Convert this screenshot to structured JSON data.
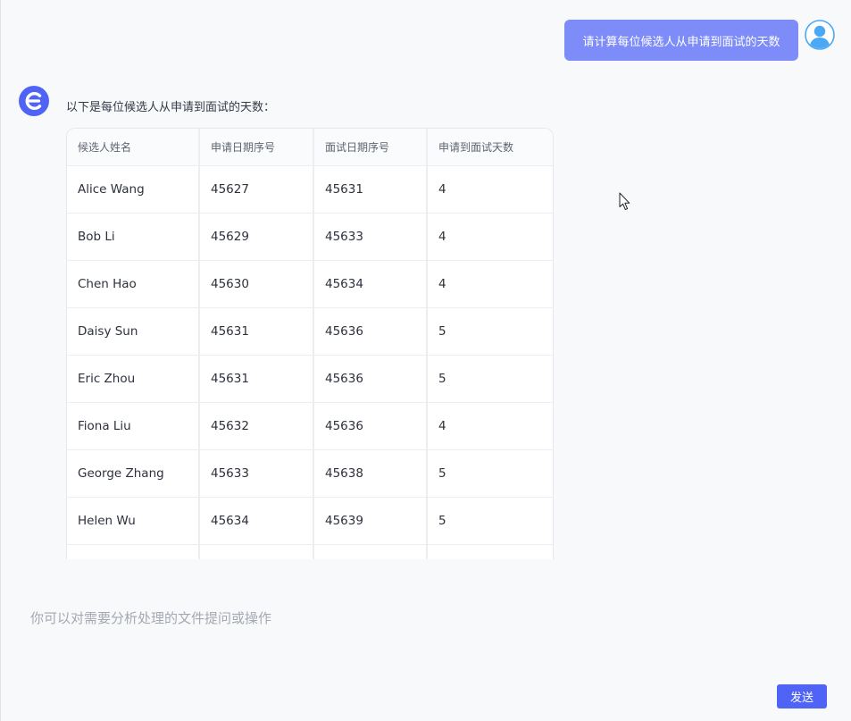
{
  "user_message": {
    "text": "请计算每位候选人从申请到面试的天数"
  },
  "assistant_message": {
    "intro": "以下是每位候选人从申请到面试的天数：",
    "table": {
      "headers": [
        "候选人姓名",
        "申请日期序号",
        "面试日期序号",
        "申请到面试天数"
      ],
      "rows": [
        [
          "Alice Wang",
          "45627",
          "45631",
          "4"
        ],
        [
          "Bob Li",
          "45629",
          "45633",
          "4"
        ],
        [
          "Chen Hao",
          "45630",
          "45634",
          "4"
        ],
        [
          "Daisy Sun",
          "45631",
          "45636",
          "5"
        ],
        [
          "Eric Zhou",
          "45631",
          "45636",
          "5"
        ],
        [
          "Fiona Liu",
          "45632",
          "45636",
          "4"
        ],
        [
          "George Zhang",
          "45633",
          "45638",
          "5"
        ],
        [
          "Helen Wu",
          "45634",
          "45639",
          "5"
        ],
        [
          "",
          "",
          "",
          ""
        ]
      ]
    }
  },
  "input": {
    "value": "",
    "placeholder": "你可以对需要分析处理的文件提问或操作"
  },
  "send_button": {
    "label": "发送"
  },
  "colors": {
    "user_bubble": "#7d8cf9",
    "send_button": "#4f64f6",
    "bot_logo": "#4f64f6",
    "user_avatar": "#4aa8f5"
  },
  "icons": {
    "user_avatar": "user-avatar-icon",
    "bot_avatar": "bot-logo-icon",
    "cursor": "mouse-pointer-icon"
  }
}
